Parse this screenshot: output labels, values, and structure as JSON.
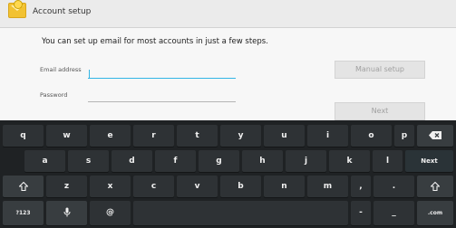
{
  "action_bar": {
    "title": "Account setup"
  },
  "form": {
    "intro": "You can set up email for most accounts in just a few steps.",
    "email_label": "Email address",
    "email_value": "",
    "password_label": "Password",
    "password_value": "",
    "manual_setup_label": "Manual setup",
    "next_label": "Next"
  },
  "keyboard": {
    "row1": [
      "q",
      "w",
      "e",
      "r",
      "t",
      "y",
      "u",
      "i",
      "o",
      "p"
    ],
    "row2": [
      "a",
      "s",
      "d",
      "f",
      "g",
      "h",
      "j",
      "k",
      "l"
    ],
    "row3": [
      "z",
      "x",
      "c",
      "v",
      "b",
      "n",
      "m",
      ",",
      "."
    ],
    "next_label": "Next",
    "sym_label": "?123",
    "at_label": "@",
    "dash_label": "-",
    "underscore_label": "_",
    "com_label": ".com"
  }
}
